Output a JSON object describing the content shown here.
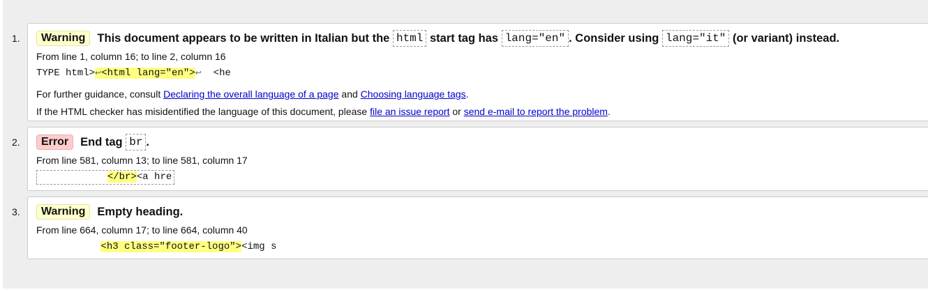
{
  "messages": [
    {
      "number": "1.",
      "type": "Warning",
      "text_before_code1": "This document appears to be written in Italian but the",
      "code1": "html",
      "text_after_code1": "start tag has",
      "code2": "lang=\"en\"",
      "text_after_code2": ". Consider using",
      "code3": "lang=\"it\"",
      "text_after_code3": "(or variant) instead.",
      "location": "From line 1, column 16; to line 2, column 16",
      "extract_before": "TYPE html>",
      "extract_lf1": "↩",
      "extract_highlight": "<html lang=\"en\">",
      "extract_lf2": "↩",
      "extract_after": "  <he",
      "guidance_prefix": "For further guidance, consult",
      "guidance_link1": "Declaring the overall language of a page",
      "guidance_and": "and",
      "guidance_link2": "Choosing language tags",
      "guidance_suffix": ".",
      "report_prefix": "If the HTML checker has misidentified the language of this document, please",
      "report_link1": "file an issue report",
      "report_or": "or",
      "report_link2": "send e-mail to report the problem",
      "report_suffix": "."
    },
    {
      "number": "2.",
      "type": "Error",
      "text_before_code1": "End tag",
      "code1": "br",
      "text_after_code1": ".",
      "location": "From line 581, column 13; to line 581, column 17",
      "extract_before": "            ",
      "extract_highlight": "</br>",
      "extract_after": "<a hre"
    },
    {
      "number": "3.",
      "type": "Warning",
      "text": "Empty heading.",
      "location": "From line 664, column 17; to line 664, column 40",
      "extract_before": "           ",
      "extract_highlight": "<h3 class=\"footer-logo\">",
      "extract_after": "<img s"
    }
  ]
}
